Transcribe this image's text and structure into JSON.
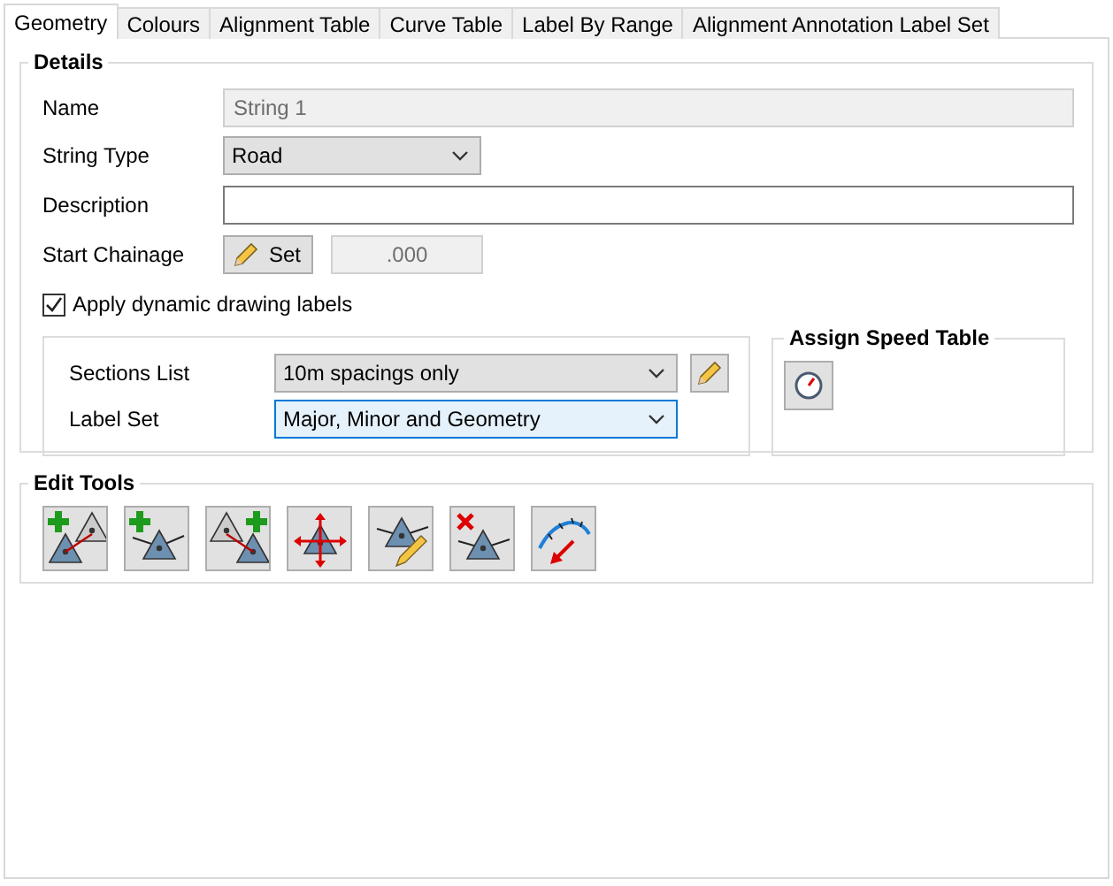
{
  "tabs": [
    {
      "label": "Geometry",
      "selected": true
    },
    {
      "label": "Colours",
      "selected": false
    },
    {
      "label": "Alignment Table",
      "selected": false
    },
    {
      "label": "Curve Table",
      "selected": false
    },
    {
      "label": "Label By Range",
      "selected": false
    },
    {
      "label": "Alignment Annotation Label Set",
      "selected": false
    }
  ],
  "details": {
    "title": "Details",
    "name": {
      "label": "Name",
      "value": "String 1",
      "disabled": true
    },
    "string_type": {
      "label": "String Type",
      "value": "Road"
    },
    "description": {
      "label": "Description"
    },
    "start_chainage": {
      "label": "Start Chainage",
      "button": "Set",
      "value": ".000",
      "disabled": true
    },
    "apply_labels": {
      "label": "Apply dynamic drawing labels",
      "checked": true
    },
    "sections_list": {
      "label": "Sections List",
      "value": "10m spacings only",
      "focused": false
    },
    "label_set": {
      "label": "Label Set",
      "value": "Major, Minor and Geometry",
      "focused": true
    },
    "speed_table": {
      "title": "Assign Speed Table"
    }
  },
  "edit_tools": {
    "title": "Edit Tools",
    "tools": [
      {
        "kind": "add-link"
      },
      {
        "kind": "add"
      },
      {
        "kind": "add-link-right"
      },
      {
        "kind": "move"
      },
      {
        "kind": "edit"
      },
      {
        "kind": "delete"
      },
      {
        "kind": "curve"
      }
    ]
  }
}
